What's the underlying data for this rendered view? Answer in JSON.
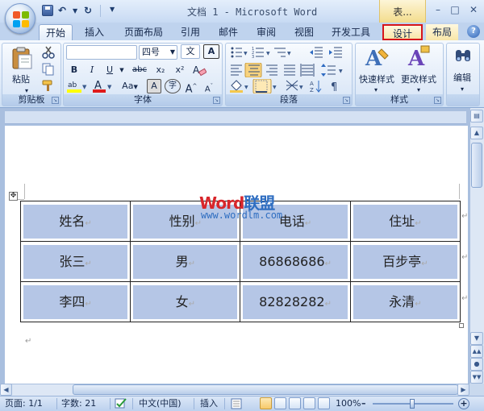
{
  "titlebar": {
    "window_title": "文档 1 - Microsoft Word",
    "context_tab_title": "表...",
    "minimize": "–",
    "restore": "□",
    "close": "✕"
  },
  "quick_access": {
    "undo": "↶",
    "redo": "↻"
  },
  "tabs": [
    "开始",
    "插入",
    "页面布局",
    "引用",
    "邮件",
    "审阅",
    "视图",
    "开发工具",
    "设计",
    "布局"
  ],
  "active_tab": "开始",
  "highlighted_tab": "设计",
  "help": "?",
  "ribbon": {
    "clipboard": {
      "label": "剪贴板",
      "paste": "粘贴"
    },
    "font": {
      "label": "字体",
      "font_name": "",
      "font_size": "四号",
      "bold": "B",
      "italic": "I",
      "underline": "U",
      "strike": "abc",
      "subscript": "x₂",
      "superscript": "x²",
      "change_case": "Aa",
      "grow": "A",
      "shrink": "A",
      "wen": "文",
      "a_box": "A",
      "zi": "字"
    },
    "paragraph": {
      "label": "段落"
    },
    "styles": {
      "label": "样式",
      "quick_styles": "快速样式",
      "change_styles": "更改样式"
    },
    "editing": {
      "label": "编辑"
    }
  },
  "watermark": {
    "word": "Word",
    "lm": "联盟",
    "url": "www.wordlm.com"
  },
  "table": {
    "header": [
      "姓名",
      "性别",
      "电话",
      "住址"
    ],
    "rows": [
      [
        "张三",
        "男",
        "86868686",
        "百步亭"
      ],
      [
        "李四",
        "女",
        "82828282",
        "永清"
      ]
    ]
  },
  "statusbar": {
    "page": "页面: 1/1",
    "words": "字数: 21",
    "language": "中文(中国)",
    "insert_mode": "插入",
    "zoom": "100%",
    "zoom_minus": "–",
    "zoom_plus": "+"
  },
  "marks": {
    "paragraph": "↵",
    "move": "✥"
  },
  "colors": {
    "ribbon_bg": "#dfeaf8",
    "table_cell": "#b5c6e6",
    "highlight_border": "#d6151a",
    "watermark_red": "#d8262b",
    "watermark_blue": "#2f6ec1"
  }
}
